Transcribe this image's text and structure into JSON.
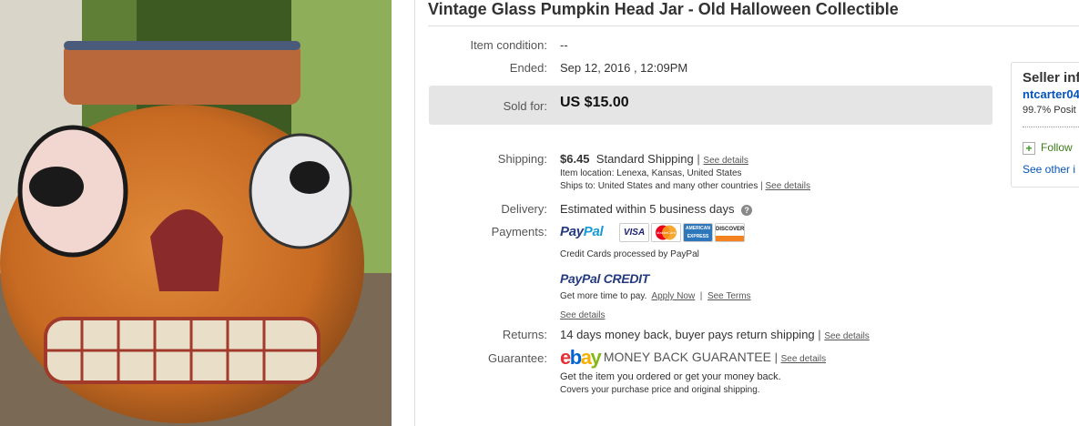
{
  "title": "Vintage Glass Pumpkin Head Jar - Old Halloween Collectible",
  "item_condition": {
    "label": "Item condition:",
    "value": "--"
  },
  "ended": {
    "label": "Ended:",
    "value": "Sep 12, 2016 , 12:09PM"
  },
  "sold": {
    "label": "Sold for:",
    "value": "US $15.00"
  },
  "shipping": {
    "label": "Shipping:",
    "cost": "$6.45",
    "method": "Standard Shipping",
    "see_details": "See details",
    "item_location": "Item location:  Lenexa, Kansas, United States",
    "ships_to": "Ships to:  United States and many other countries",
    "ships_see_details": "See details"
  },
  "delivery": {
    "label": "Delivery:",
    "value": "Estimated within 5 business days",
    "help": "?"
  },
  "payments": {
    "label": "Payments:",
    "paypal_a": "Pay",
    "paypal_b": "Pal",
    "cards": [
      "VISA",
      "MasterCard",
      "AMERICAN EXPRESS",
      "DISCOVER"
    ],
    "cards_note": "Credit Cards processed by PayPal",
    "credit_a": "PayPal",
    "credit_b": " CREDIT",
    "credit_text": "Get more time to pay.",
    "apply_now": "Apply Now",
    "see_terms": "See Terms",
    "see_details": "See details"
  },
  "returns": {
    "label": "Returns:",
    "value": "14 days money back, buyer pays return shipping",
    "see_details": "See details"
  },
  "guarantee": {
    "label": "Guarantee:",
    "ebay_letters": [
      "e",
      "b",
      "a",
      "y"
    ],
    "mbg": "MONEY BACK GUARANTEE",
    "see_details": "See details",
    "line1": "Get the item you ordered or get your money back.",
    "line2": "Covers your purchase price and original shipping."
  },
  "seller": {
    "heading": "Seller inf",
    "name": "ntcarter04",
    "feedback": "99.7% Posit",
    "follow": "Follow",
    "see_other": "See other i"
  },
  "colors": {
    "ebay_e": "#e53238",
    "ebay_b": "#0064d2",
    "ebay_a": "#f5af02",
    "ebay_y": "#86b817"
  }
}
